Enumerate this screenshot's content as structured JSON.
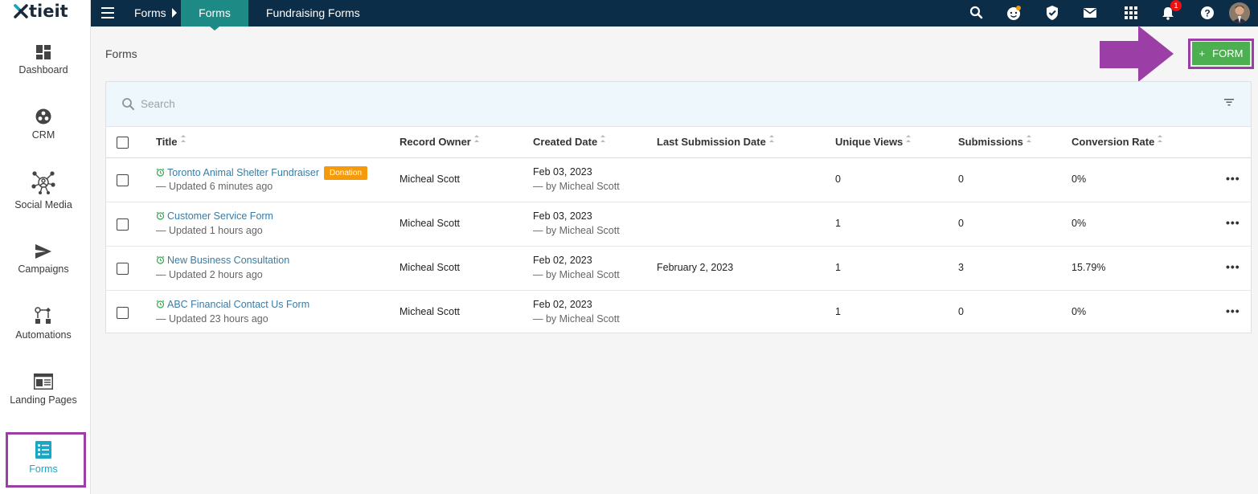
{
  "app": {
    "logo_text": "tieit"
  },
  "sidebar": {
    "items": [
      {
        "label": "Dashboard",
        "icon": "dashboard-icon"
      },
      {
        "label": "CRM",
        "icon": "crm-icon"
      },
      {
        "label": "Social Media",
        "icon": "social-media-icon"
      },
      {
        "label": "Campaigns",
        "icon": "send-icon"
      },
      {
        "label": "Automations",
        "icon": "automation-icon"
      },
      {
        "label": "Landing Pages",
        "icon": "landing-page-icon"
      },
      {
        "label": "Forms",
        "icon": "forms-icon",
        "active": true
      }
    ]
  },
  "topbar": {
    "breadcrumb": "Forms",
    "tabs": [
      {
        "label": "Forms",
        "active": true
      },
      {
        "label": "Fundraising Forms",
        "active": false
      }
    ],
    "notification_count": "1",
    "colors": {
      "bar": "#0c2d48",
      "active_tab": "#1e8a85"
    }
  },
  "page": {
    "title": "Forms",
    "add_button_label": "FORM",
    "add_button_icon": "+",
    "accent_green": "#4caf50",
    "highlight_purple": "#9b3fa6"
  },
  "search": {
    "placeholder": "Search"
  },
  "table": {
    "columns": [
      "Title",
      "Record Owner",
      "Created Date",
      "Last Submission Date",
      "Unique Views",
      "Submissions",
      "Conversion Rate"
    ],
    "rows": [
      {
        "title": "Toronto Animal Shelter Fundraiser",
        "badge": "Donation",
        "updated": "— Updated 6 minutes ago",
        "owner": "Micheal Scott",
        "created": "Feb 03, 2023",
        "created_by": "— by Micheal Scott",
        "last_submission": "",
        "views": "0",
        "submissions": "0",
        "conversion": "0%"
      },
      {
        "title": "Customer Service Form",
        "badge": "",
        "updated": "— Updated 1 hours ago",
        "owner": "Micheal Scott",
        "created": "Feb 03, 2023",
        "created_by": "— by Micheal Scott",
        "last_submission": "",
        "views": "1",
        "submissions": "0",
        "conversion": "0%"
      },
      {
        "title": "New Business Consultation",
        "badge": "",
        "updated": "— Updated 2 hours ago",
        "owner": "Micheal Scott",
        "created": "Feb 02, 2023",
        "created_by": "— by Micheal Scott",
        "last_submission": "February 2, 2023",
        "views": "1",
        "submissions": "3",
        "conversion": "15.79%"
      },
      {
        "title": "ABC Financial Contact Us Form",
        "badge": "",
        "updated": "— Updated 23 hours ago",
        "owner": "Micheal Scott",
        "created": "Feb 02, 2023",
        "created_by": "— by Micheal Scott",
        "last_submission": "",
        "views": "1",
        "submissions": "0",
        "conversion": "0%"
      }
    ],
    "row_menu_icon": "more-horizontal-icon",
    "row_menu_text": "•••"
  }
}
